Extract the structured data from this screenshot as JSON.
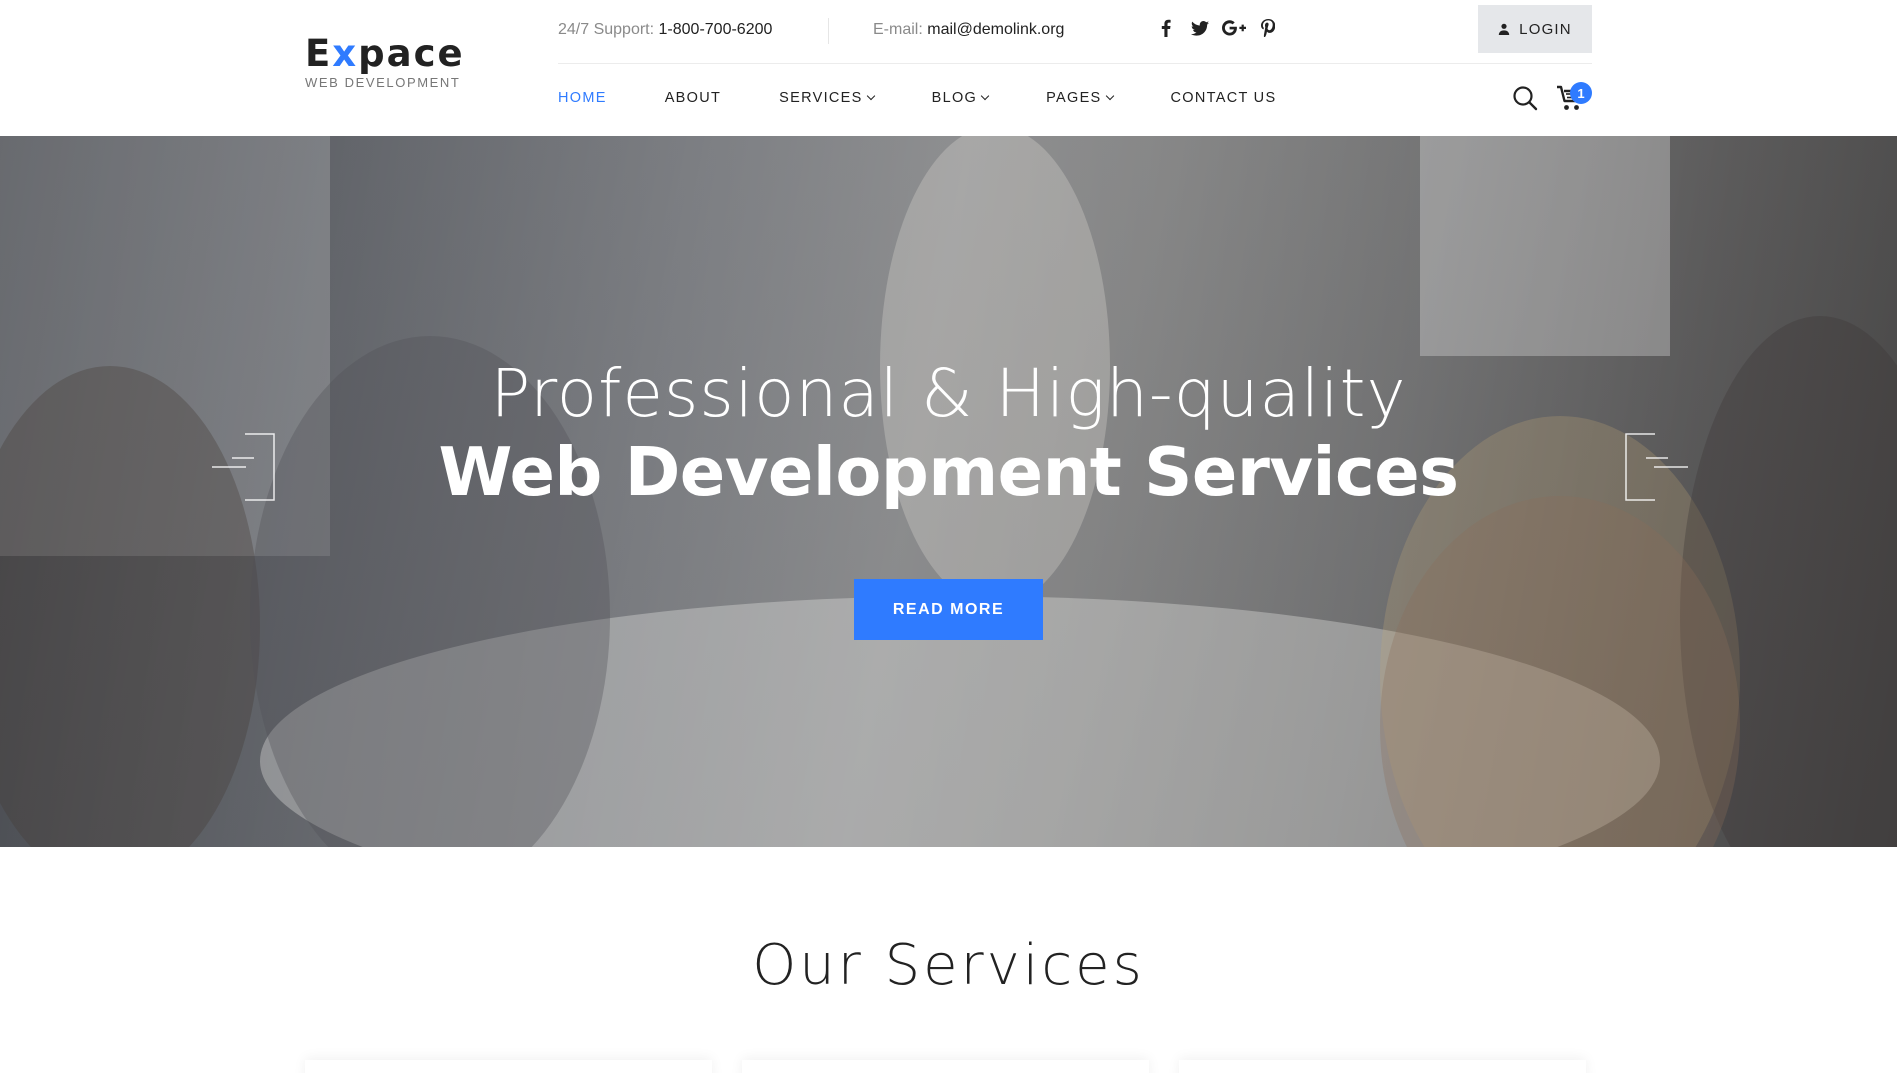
{
  "brand": {
    "name_prefix": "E",
    "name_accent": "x",
    "name_suffix": "pace",
    "tagline": "WEB DEVELOPMENT",
    "accent_color": "#2f7bff"
  },
  "topbar": {
    "support_label": "24/7 Support:",
    "support_phone": "1-800-700-6200",
    "email_label": "E-mail:",
    "email_value": "mail@demolink.org",
    "socials": [
      "facebook-icon",
      "twitter-icon",
      "google-plus-icon",
      "pinterest-icon"
    ],
    "social_glyphs": [
      "f",
      "t",
      "G+",
      "P"
    ],
    "login_label": "LOGIN"
  },
  "nav": {
    "items": [
      {
        "label": "HOME",
        "active": true
      },
      {
        "label": "ABOUT"
      },
      {
        "label": "SERVICES",
        "dropdown": true
      },
      {
        "label": "BLOG",
        "dropdown": true
      },
      {
        "label": "PAGES",
        "dropdown": true
      },
      {
        "label": "CONTACT US"
      }
    ],
    "cart_count": "1"
  },
  "hero": {
    "line1": "Professional & High-quality",
    "line2": "Web Development Services",
    "button_label": "READ MORE"
  },
  "services": {
    "title": "Our Services"
  }
}
